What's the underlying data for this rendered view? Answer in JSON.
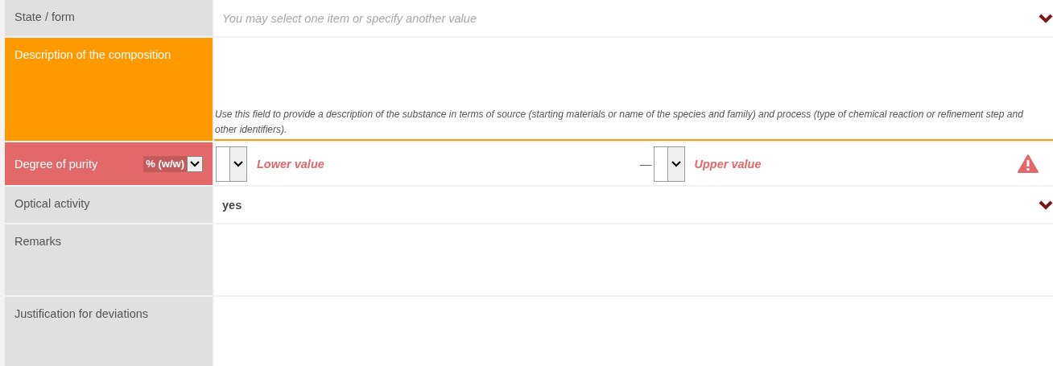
{
  "fields": [
    {
      "kind": "select",
      "label": "State / form",
      "placeholder": "You may select one item or specify another value",
      "focused": false,
      "error": false
    },
    {
      "kind": "text",
      "label": "Description of the composition",
      "hint": "Use this field to provide a description of the substance in terms of source (starting materials or name of the species and family) and process (type of chemical reaction or refinement step and other identifiers).",
      "focused": true,
      "error": false
    },
    {
      "kind": "range",
      "label": "Degree of purity",
      "unit": "% (w/w)",
      "lower_placeholder": "Lower value",
      "separator": "—",
      "upper_placeholder": "Upper value",
      "focused": false,
      "error": true
    },
    {
      "kind": "select",
      "label": "Optical activity",
      "value": "yes",
      "focused": false,
      "error": false
    },
    {
      "kind": "text",
      "label": "Remarks",
      "focused": false,
      "error": false
    },
    {
      "kind": "text",
      "label": "Justification for deviations",
      "focused": false,
      "error": false
    }
  ]
}
